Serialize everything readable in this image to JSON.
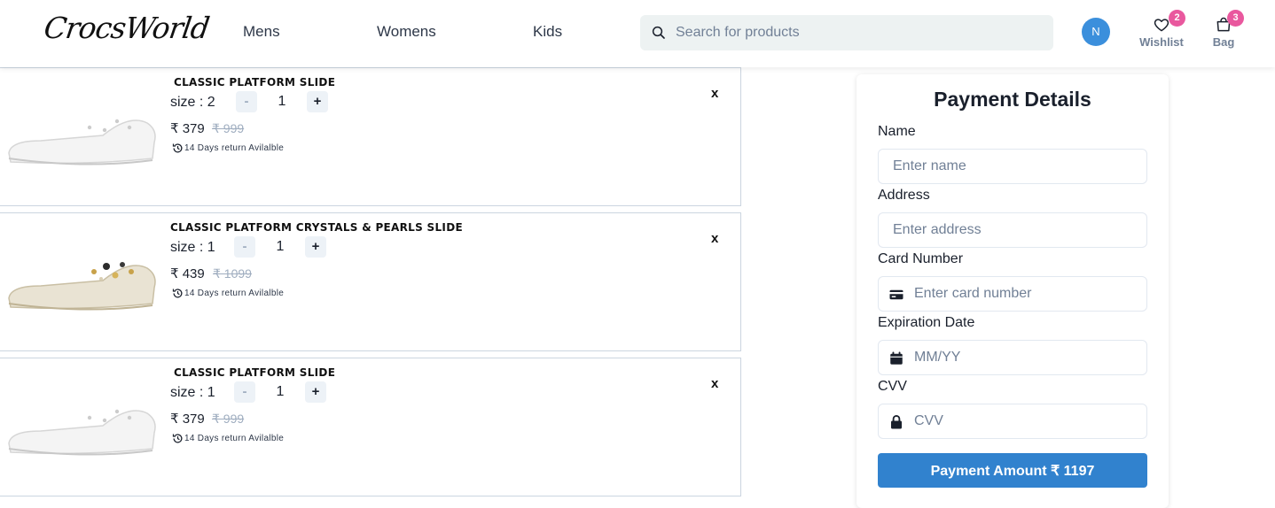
{
  "header": {
    "logo": "CrocsWorld",
    "nav": [
      "Mens",
      "Womens",
      "Kids"
    ],
    "search_placeholder": "Search for products",
    "avatar_initial": "N",
    "wishlist": {
      "label": "Wishlist",
      "count": "2"
    },
    "bag": {
      "label": "Bag",
      "count": "3"
    }
  },
  "cart": {
    "return_text": "14 Days return Avilalble",
    "remove_label": "x",
    "minus_label": "-",
    "plus_label": "+",
    "items": [
      {
        "title": "CLASSIC PLATFORM SLIDE",
        "size": "size : 2",
        "qty": "1",
        "price": "₹ 379",
        "mrp": "₹ 999",
        "color": "#f2f2f2"
      },
      {
        "title": "CLASSIC PLATFORM CRYSTALS & PEARLS SLIDE",
        "size": "size : 1",
        "qty": "1",
        "price": "₹ 439",
        "mrp": "₹ 1099",
        "color": "#e9e3d3"
      },
      {
        "title": "CLASSIC PLATFORM SLIDE",
        "size": "size : 1",
        "qty": "1",
        "price": "₹ 379",
        "mrp": "₹ 999",
        "color": "#f2f2f2"
      }
    ]
  },
  "payment": {
    "title": "Payment Details",
    "fields": [
      {
        "label": "Name",
        "placeholder": "Enter name"
      },
      {
        "label": "Address",
        "placeholder": "Enter address"
      },
      {
        "label": "Card Number",
        "placeholder": "Enter card number",
        "icon": "credit-card-icon"
      },
      {
        "label": "Expiration Date",
        "placeholder": "MM/YY",
        "icon": "calendar-icon"
      },
      {
        "label": "CVV",
        "placeholder": "CVV",
        "icon": "lock-icon"
      }
    ],
    "button": "Payment Amount ₹ 1197"
  },
  "colors": {
    "accent": "#3182ce",
    "badge": "#e9589e",
    "avatar": "#3b8fdc"
  }
}
